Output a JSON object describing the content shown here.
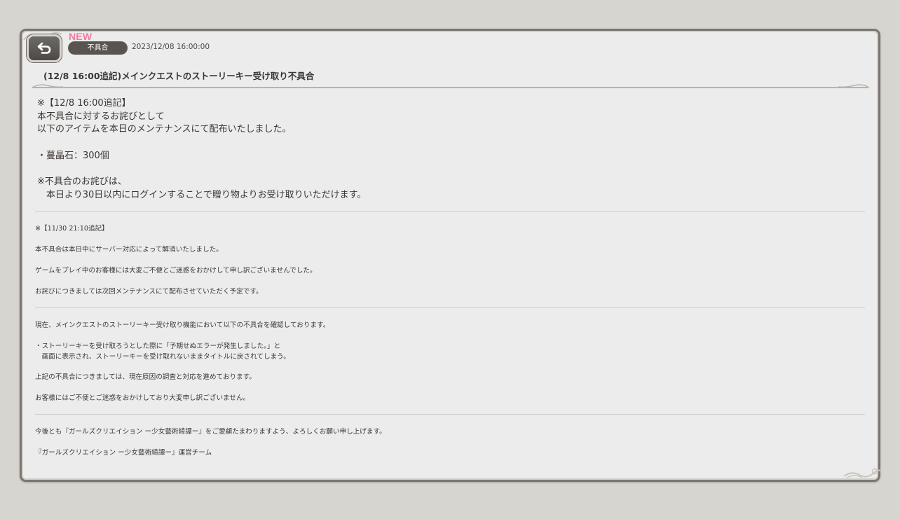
{
  "header": {
    "new_label": "NEW",
    "category": "不具合",
    "date": "2023/12/08 16:00:00",
    "title": "(12/8 16:00追記)メインクエストのストーリーキー受け取り不具合",
    "back_icon": "back-arrow-icon"
  },
  "body": {
    "section1": [
      "※【12/8 16:00追記】",
      "本不具合に対するお詫びとして",
      "以下のアイテムを本日のメンテナンスにて配布いたしました。",
      "・蔓晶石：300個",
      "※不具合のお詫びは、",
      "　本日より30日以内にログインすることで贈り物よりお受け取りいただけます。"
    ],
    "section2": [
      "※【11/30 21:10追記】",
      "本不具合は本日中にサーバー対応によって解消いたしました。",
      "ゲームをプレイ中のお客様には大変ご不便とご迷惑をおかけして申し訳ございませんでした。",
      "お詫びにつきましては次回メンテナンスにて配布させていただく予定です。"
    ],
    "section3": [
      "現在、メインクエストのストーリーキー受け取り機能において以下の不具合を確認しております。",
      "・ストーリーキーを受け取ろうとした際に「予期せぬエラーが発生しました。」と",
      "　画面に表示され、ストーリーキーを受け取れないままタイトルに戻されてしまう。",
      "上記の不具合につきましては、現在原因の調査と対応を進めております。",
      "お客様にはご不便とご迷惑をおかけしており大変申し訳ございません。"
    ],
    "section4": [
      "今後とも『ガールズクリエイション ー少女藝術綺譚ー』をご愛顧たまわりますよう、よろしくお願い申し上げます。",
      "『ガールズクリエイション ー少女藝術綺譚ー』運営チーム"
    ]
  }
}
